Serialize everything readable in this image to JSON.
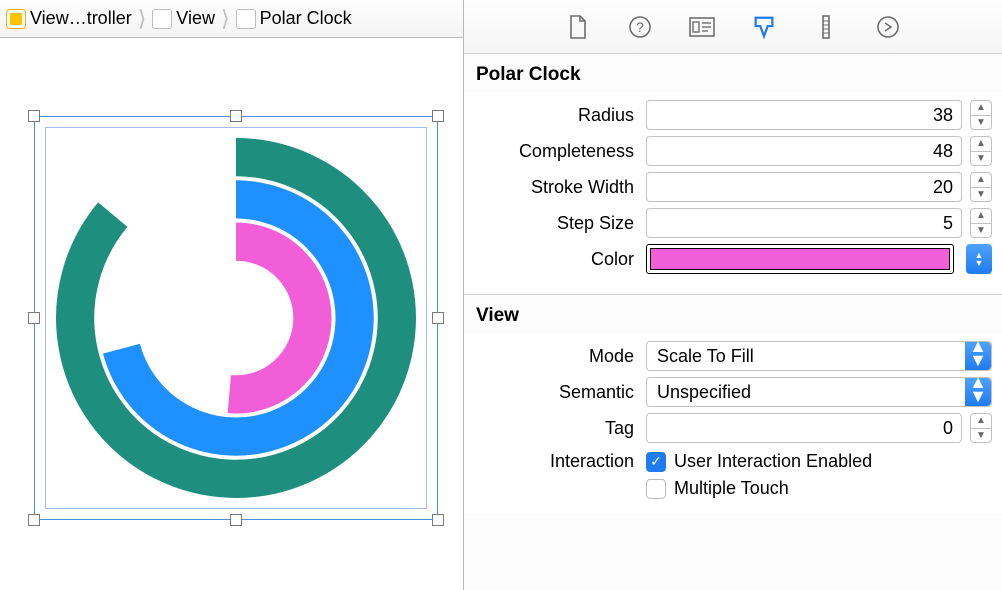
{
  "breadcrumb": {
    "items": [
      {
        "label": "View…troller"
      },
      {
        "label": "View"
      },
      {
        "label": "Polar Clock"
      }
    ]
  },
  "inspector": {
    "section1_title": "Polar Clock",
    "radius_label": "Radius",
    "radius_value": "38",
    "completeness_label": "Completeness",
    "completeness_value": "48",
    "stroke_width_label": "Stroke Width",
    "stroke_width_value": "20",
    "step_size_label": "Step Size",
    "step_size_value": "5",
    "color_label": "Color",
    "color_value": "#f25ed8",
    "section2_title": "View",
    "mode_label": "Mode",
    "mode_value": "Scale To Fill",
    "semantic_label": "Semantic",
    "semantic_value": "Unspecified",
    "tag_label": "Tag",
    "tag_value": "0",
    "interaction_label": "Interaction",
    "user_interaction_label": "User Interaction Enabled",
    "multiple_touch_label": "Multiple Touch"
  },
  "clock": {
    "rings": [
      {
        "color": "#1e8e7e",
        "arc_end_deg": 310
      },
      {
        "color": "#1e90ff",
        "arc_end_deg": 255
      },
      {
        "color": "#f25ed8",
        "arc_end_deg": 185
      }
    ]
  }
}
